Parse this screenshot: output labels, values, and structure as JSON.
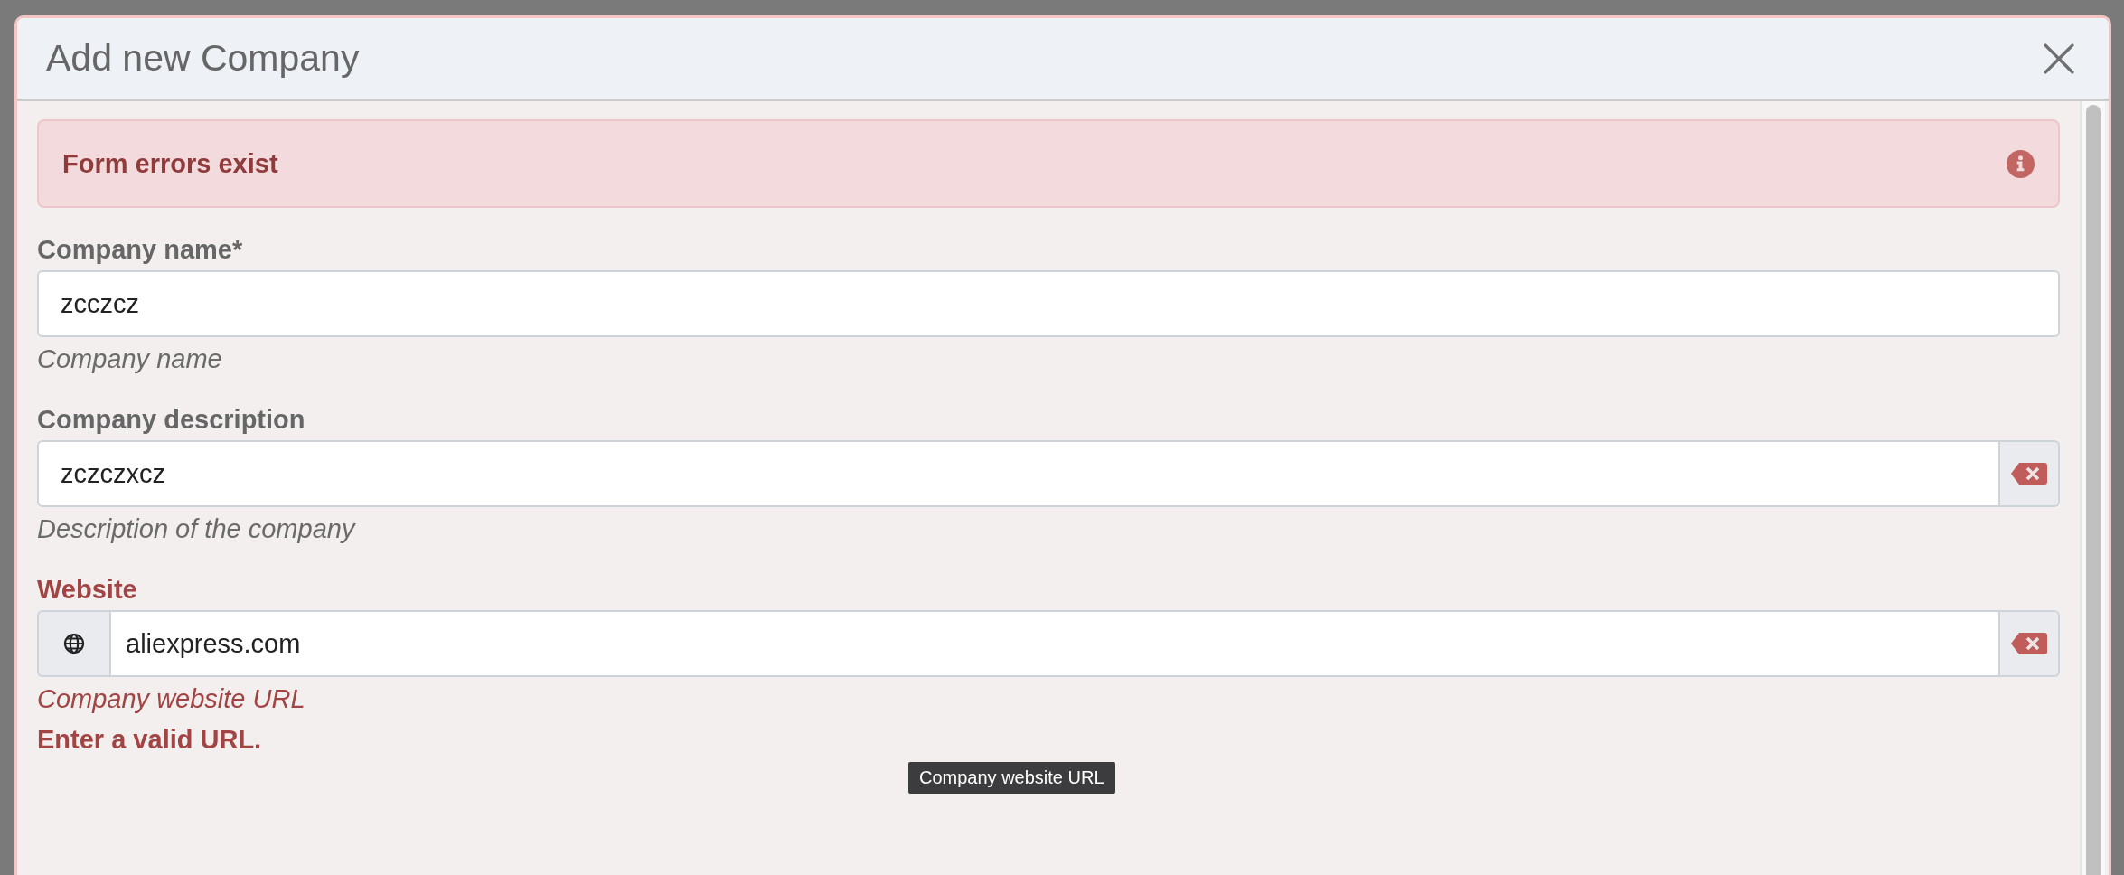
{
  "modal": {
    "title": "Add new Company"
  },
  "alert": {
    "message": "Form errors exist"
  },
  "fields": [
    {
      "kind": "plain",
      "label": "Company name*",
      "value": "zcczcz",
      "help": "Company name",
      "invalid": false
    },
    {
      "kind": "clearable",
      "label": "Company description",
      "value": "zczczxcz",
      "help": "Description of the company",
      "invalid": false
    },
    {
      "kind": "url",
      "label": "Website",
      "value": "aliexpress.com",
      "help": "Company website URL",
      "invalid": true,
      "error": "Enter a valid URL."
    }
  ],
  "tooltip": {
    "text": "Company website URL"
  }
}
